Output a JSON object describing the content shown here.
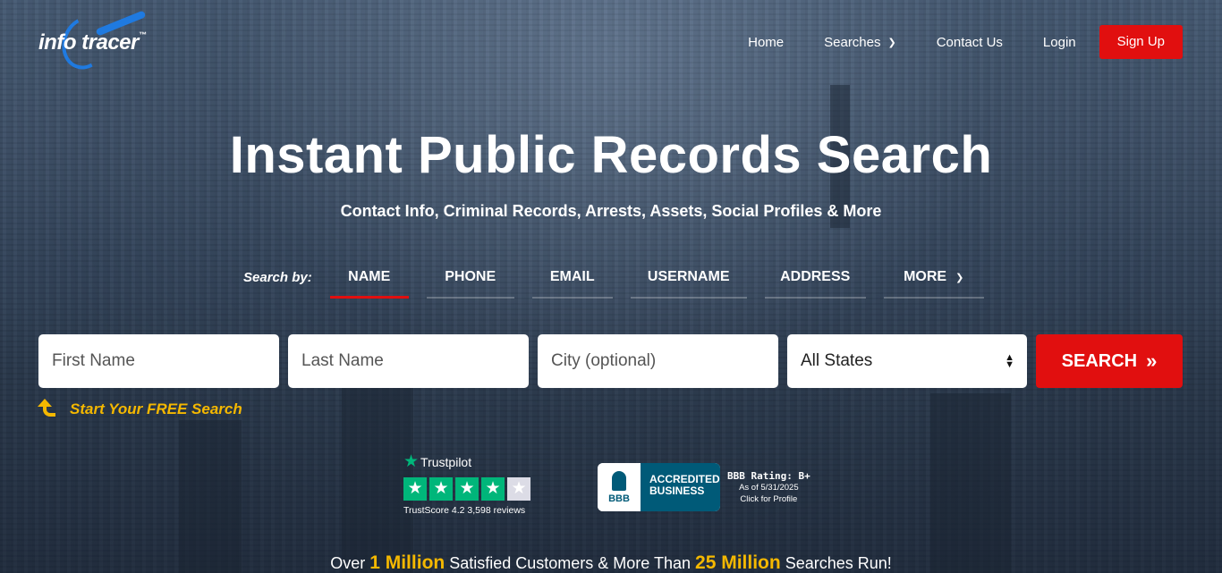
{
  "brand": {
    "name_left": "info",
    "name_right": "tracer",
    "trademark": "™",
    "accent_color": "#1f7ae0"
  },
  "nav": {
    "home": "Home",
    "searches": "Searches",
    "contact": "Contact Us",
    "login": "Login",
    "signup": "Sign Up",
    "signup_color": "#e10f0f"
  },
  "hero": {
    "title": "Instant Public Records Search",
    "subtitle": "Contact Info, Criminal Records, Arrests, Assets, Social Profiles & More"
  },
  "search_tabs": {
    "label": "Search by:",
    "items": [
      {
        "label": "NAME",
        "active": true
      },
      {
        "label": "PHONE",
        "active": false
      },
      {
        "label": "EMAIL",
        "active": false
      },
      {
        "label": "USERNAME",
        "active": false
      },
      {
        "label": "ADDRESS",
        "active": false
      },
      {
        "label": "MORE",
        "active": false
      }
    ]
  },
  "search_form": {
    "first_name_placeholder": "First Name",
    "last_name_placeholder": "Last Name",
    "city_placeholder": "City (optional)",
    "state_selected": "All States",
    "button_label": "SEARCH",
    "free_prompt": "Start Your FREE Search"
  },
  "trustpilot": {
    "brand": "Trustpilot",
    "stars_filled": 4,
    "stars_total": 5,
    "score_text": "TrustScore 4.2 3,598 reviews"
  },
  "bbb": {
    "logo_text": "BBB",
    "badge_line1": "ACCREDITED",
    "badge_line2": "BUSINESS",
    "rating": "BBB Rating: B+",
    "as_of": "As of 5/31/2025",
    "profile_link": "Click for Profile"
  },
  "stats": {
    "prefix": "Over ",
    "customers": "1 Million",
    "middle": " Satisfied Customers & More Than ",
    "searches": "25 Million",
    "suffix": " Searches Run!"
  }
}
